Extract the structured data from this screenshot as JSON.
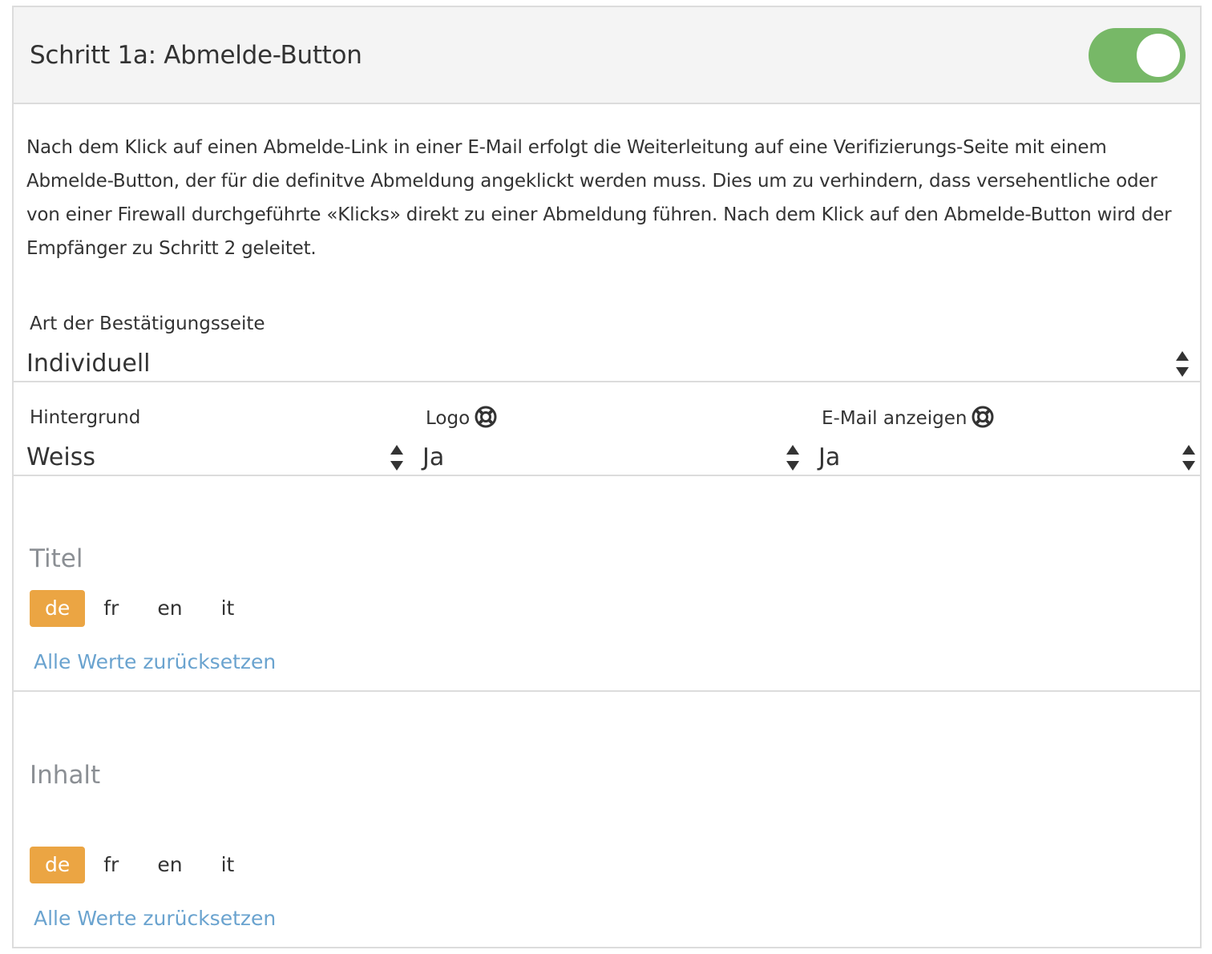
{
  "header": {
    "title": "Schritt 1a: Abmelde-Button",
    "toggle_on": true,
    "toggle_color": "#77b867"
  },
  "description": "Nach dem Klick auf einen Abmelde-Link in einer E-Mail erfolgt die Weiterleitung auf eine Verifizierungs-Seite mit einem Abmelde-Button, der für die definitve Abmeldung angeklickt werden muss. Dies um zu verhindern, dass versehentliche oder von einer Firewall durchgeführte «Klicks» direkt zu einer Abmeldung führen. Nach dem Klick auf den Abmelde-Button wird der Empfänger zu Schritt 2 geleitet.",
  "confirmation_page": {
    "label": "Art der Bestätigungsseite",
    "value": "Individuell"
  },
  "background": {
    "label": "Hintergrund",
    "value": "Weiss"
  },
  "logo": {
    "label": "Logo",
    "value": "Ja",
    "icon": "lifebuoy-icon"
  },
  "show_email": {
    "label": "E-Mail anzeigen",
    "value": "Ja",
    "icon": "lifebuoy-icon"
  },
  "title_section": {
    "label": "Titel",
    "tabs": [
      "de",
      "fr",
      "en",
      "it"
    ],
    "active_tab": "de",
    "reset_label": "Alle Werte zurücksetzen"
  },
  "content_section": {
    "label": "Inhalt",
    "tabs": [
      "de",
      "fr",
      "en",
      "it"
    ],
    "active_tab": "de",
    "reset_label": "Alle Werte zurücksetzen"
  },
  "colors": {
    "accent_orange": "#eba543",
    "link_blue": "#6aa3cf",
    "toggle_green": "#77b867"
  }
}
